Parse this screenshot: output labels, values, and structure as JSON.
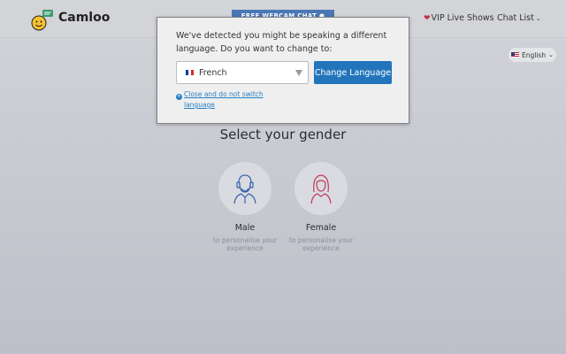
{
  "header": {
    "brand": "Camloo",
    "promo_text": "FREE WEBCAM CHAT ●",
    "nav": [
      {
        "label": "VIP Live Shows"
      },
      {
        "label": "Chat List"
      }
    ],
    "language_pill": "English"
  },
  "main": {
    "title": "Select your gender",
    "genders": [
      {
        "label": "Male",
        "sub": "to personalise your experience"
      },
      {
        "label": "Female",
        "sub": "to personalise your experience"
      }
    ]
  },
  "modal": {
    "message": "We've detected you might be speaking a different language. Do you want to change to:",
    "selected_language": "French",
    "change_button": "Change Language",
    "close_link": "Close and do not switch language"
  },
  "icons": {
    "logo": "chat-emoji-logo-icon",
    "heart": "heart-icon",
    "us_flag": "us-flag-icon",
    "fr_flag": "fr-flag-icon",
    "male": "male-avatar-icon",
    "female": "female-avatar-icon",
    "close": "close-icon"
  },
  "colors": {
    "accent": "#2275bb",
    "link": "#2a7fc0",
    "heart": "#c0323e",
    "male_icon": "#3a62b0",
    "female_icon": "#c23a5a"
  }
}
